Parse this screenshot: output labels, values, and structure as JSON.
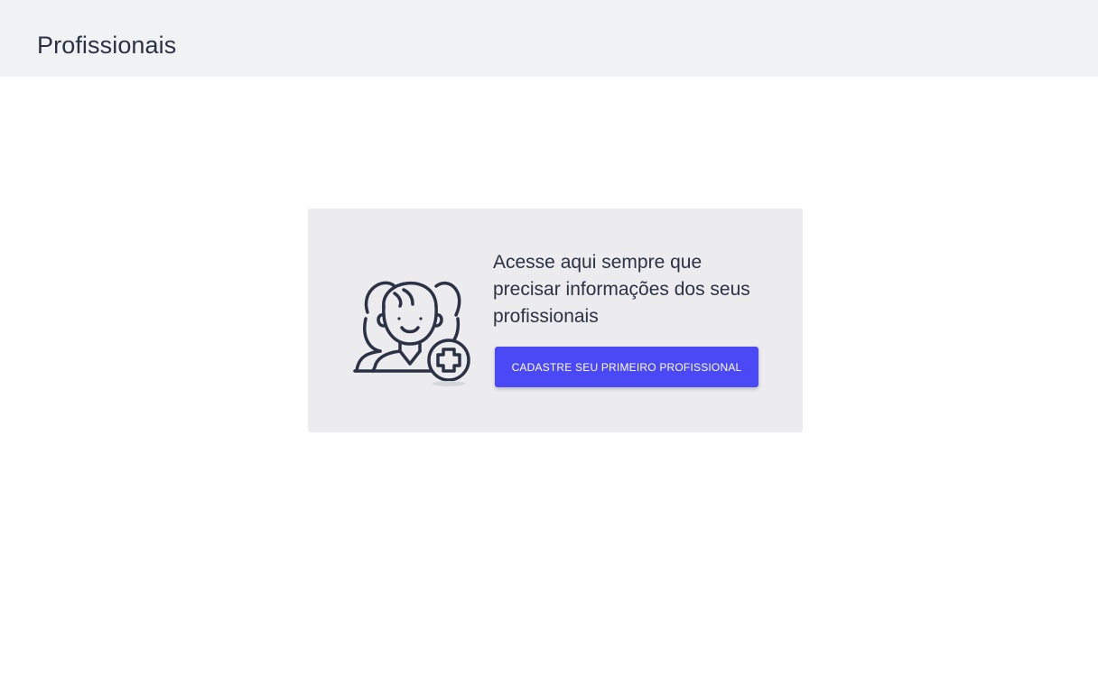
{
  "header": {
    "title": "Profissionais"
  },
  "empty_state": {
    "icon": "professional-add-icon",
    "message": "Acesse aqui sempre que precisar informações dos seus profissionais",
    "button_label": "CADASTRE SEU PRIMEIRO PROFISSIONAL"
  },
  "colors": {
    "header_bg": "#f1f2f4",
    "card_bg": "#ececee",
    "primary": "#4a49f5",
    "text": "#2b3245"
  }
}
